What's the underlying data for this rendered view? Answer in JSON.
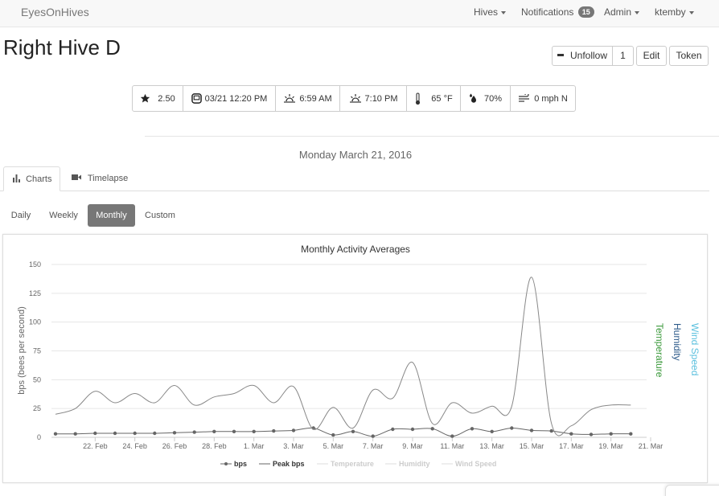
{
  "nav": {
    "brand": "EyesOnHives",
    "hives": "Hives",
    "notifications": "Notifications",
    "notification_count": "15",
    "admin": "Admin",
    "user": "ktemby"
  },
  "hive": {
    "title": "Right Hive D",
    "unfollow": "Unfollow",
    "follow_count": "1",
    "edit": "Edit",
    "token": "Token"
  },
  "stats": {
    "rating": "2.50",
    "datetime": "03/21 12:20 PM",
    "sunrise": "6:59 AM",
    "sunset": "7:10 PM",
    "temperature": "65 °F",
    "humidity": "70%",
    "wind": "0 mph N"
  },
  "date_heading": "Monday March 21, 2016",
  "tabs": {
    "charts": "Charts",
    "timelapse": "Timelapse"
  },
  "periods": {
    "daily": "Daily",
    "weekly": "Weekly",
    "monthly": "Monthly",
    "custom": "Custom"
  },
  "colors": {
    "temperature": "#3c9a3c",
    "humidity": "#2c5a8a",
    "wind": "#5bc0de",
    "line": "#888888",
    "bps": "#666666"
  },
  "chart_data": {
    "type": "line",
    "title": "Monthly Activity Averages",
    "ylabel": "bps (bees per second)",
    "right_axis_labels": [
      "Temperature",
      "Humidity",
      "Wind Speed"
    ],
    "ylim": [
      0,
      150
    ],
    "yticks": [
      0,
      25,
      50,
      75,
      100,
      125,
      150
    ],
    "x_range": [
      "2016-02-20",
      "2016-03-21"
    ],
    "xticks": [
      "22. Feb",
      "24. Feb",
      "26. Feb",
      "28. Feb",
      "1. Mar",
      "3. Mar",
      "5. Mar",
      "7. Mar",
      "9. Mar",
      "11. Mar",
      "13. Mar",
      "15. Mar",
      "17. Mar",
      "19. Mar",
      "21. Mar"
    ],
    "legend": [
      "bps",
      "Peak bps",
      "Temperature",
      "Humidity",
      "Wind Speed"
    ],
    "legend_enabled": [
      true,
      true,
      false,
      false,
      false
    ],
    "series": [
      {
        "name": "bps",
        "x": [
          "2016-02-20",
          "2016-02-21",
          "2016-02-22",
          "2016-02-23",
          "2016-02-24",
          "2016-02-25",
          "2016-02-26",
          "2016-02-27",
          "2016-02-28",
          "2016-02-29",
          "2016-03-01",
          "2016-03-02",
          "2016-03-03",
          "2016-03-04",
          "2016-03-05",
          "2016-03-06",
          "2016-03-07",
          "2016-03-08",
          "2016-03-09",
          "2016-03-10",
          "2016-03-11",
          "2016-03-12",
          "2016-03-13",
          "2016-03-14",
          "2016-03-15",
          "2016-03-16",
          "2016-03-17",
          "2016-03-18",
          "2016-03-19",
          "2016-03-20"
        ],
        "values": [
          3,
          3,
          3.5,
          3.5,
          3.5,
          3.5,
          4,
          4.5,
          5,
          5,
          5,
          5.5,
          6,
          8,
          2,
          5,
          1,
          7,
          7,
          7.5,
          1,
          7.5,
          5,
          8,
          6,
          5.5,
          3,
          2.5,
          3,
          3
        ]
      },
      {
        "name": "Peak bps",
        "x": [
          "2016-02-20",
          "2016-02-21",
          "2016-02-22",
          "2016-02-23",
          "2016-02-24",
          "2016-02-25",
          "2016-02-26",
          "2016-02-27",
          "2016-02-28",
          "2016-02-29",
          "2016-03-01",
          "2016-03-02",
          "2016-03-03",
          "2016-03-04",
          "2016-03-05",
          "2016-03-06",
          "2016-03-07",
          "2016-03-08",
          "2016-03-09",
          "2016-03-10",
          "2016-03-11",
          "2016-03-12",
          "2016-03-13",
          "2016-03-14",
          "2016-03-15",
          "2016-03-16",
          "2016-03-17",
          "2016-03-18",
          "2016-03-19",
          "2016-03-20"
        ],
        "values": [
          20,
          25,
          40,
          30,
          38,
          30,
          45,
          28,
          35,
          38,
          45,
          30,
          44,
          7,
          26,
          8,
          41,
          34,
          65,
          12,
          30,
          21,
          27,
          27,
          139,
          12,
          10,
          24,
          28,
          28
        ]
      }
    ]
  }
}
